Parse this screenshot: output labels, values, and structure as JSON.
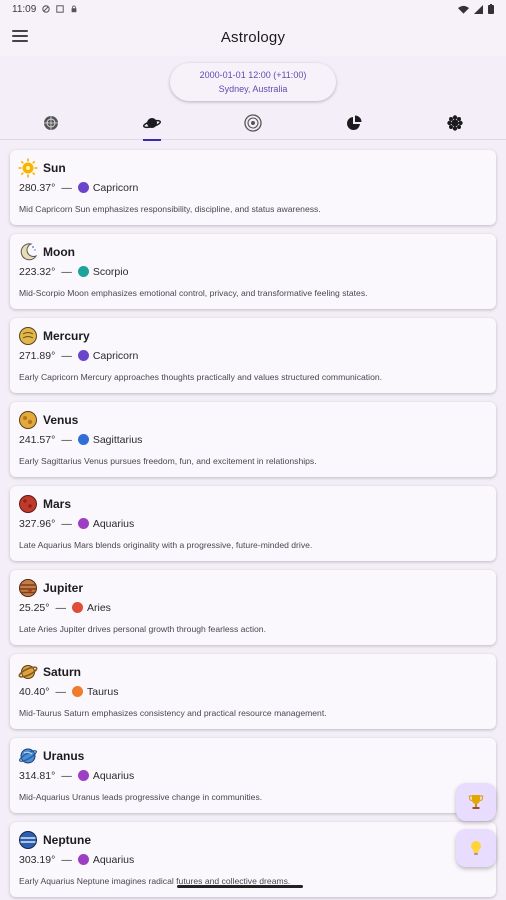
{
  "status_bar": {
    "time": "11:09"
  },
  "app_bar": {
    "title": "Astrology"
  },
  "date_chip": {
    "datetime": "2000-01-01 12:00 (+11:00)",
    "location": "Sydney, Australia"
  },
  "tabs": [
    {
      "icon": "wheel-icon",
      "active": false
    },
    {
      "icon": "planet-icon",
      "active": true
    },
    {
      "icon": "houses-icon",
      "active": false
    },
    {
      "icon": "pie-chart-icon",
      "active": false
    },
    {
      "icon": "aspects-icon",
      "active": false
    }
  ],
  "planets": [
    {
      "name": "Sun",
      "degree": "280.37°",
      "sep": "—",
      "sign": "Capricorn",
      "sign_color": "#6b45c9",
      "planet_color": "#f4b400",
      "description": "Mid Capricorn Sun emphasizes responsibility, discipline, and status awareness."
    },
    {
      "name": "Moon",
      "degree": "223.32°",
      "sep": "—",
      "sign": "Scorpio",
      "sign_color": "#1ba39c",
      "planet_color": "#e8dcb5",
      "description": "Mid-Scorpio Moon emphasizes emotional control, privacy, and transformative feeling states."
    },
    {
      "name": "Mercury",
      "degree": "271.89°",
      "sep": "—",
      "sign": "Capricorn",
      "sign_color": "#6b45c9",
      "planet_color": "#e0b84a",
      "description": "Early Capricorn Mercury approaches thoughts practically and values structured communication."
    },
    {
      "name": "Venus",
      "degree": "241.57°",
      "sep": "—",
      "sign": "Sagittarius",
      "sign_color": "#2f6fd6",
      "planet_color": "#e3a93a",
      "description": "Early Sagittarius Venus pursues freedom, fun, and excitement in relationships."
    },
    {
      "name": "Mars",
      "degree": "327.96°",
      "sep": "—",
      "sign": "Aquarius",
      "sign_color": "#9c3fc4",
      "planet_color": "#c0392b",
      "description": "Late Aquarius Mars blends originality with a progressive, future-minded drive."
    },
    {
      "name": "Jupiter",
      "degree": "25.25°",
      "sep": "—",
      "sign": "Aries",
      "sign_color": "#e04b3a",
      "planet_color": "#c77b45",
      "description": "Late Aries Jupiter drives personal growth through fearless action."
    },
    {
      "name": "Saturn",
      "degree": "40.40°",
      "sep": "—",
      "sign": "Taurus",
      "sign_color": "#f07b2c",
      "planet_color": "#d9a441",
      "description": "Mid-Taurus Saturn emphasizes consistency and practical resource management."
    },
    {
      "name": "Uranus",
      "degree": "314.81°",
      "sep": "—",
      "sign": "Aquarius",
      "sign_color": "#9c3fc4",
      "planet_color": "#4a8fd8",
      "description": "Mid-Aquarius Uranus leads progressive change in communities."
    },
    {
      "name": "Neptune",
      "degree": "303.19°",
      "sep": "—",
      "sign": "Aquarius",
      "sign_color": "#9c3fc4",
      "planet_color": "#2b5fb3",
      "description": "Early Aquarius Neptune imagines radical futures and collective dreams."
    }
  ],
  "fabs": {
    "top": "trophy-icon",
    "bottom": "lightbulb-icon"
  }
}
